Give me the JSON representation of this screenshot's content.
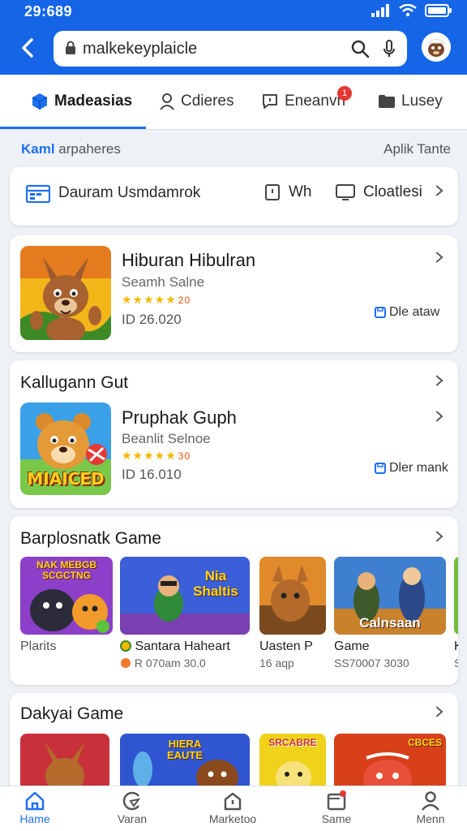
{
  "status": {
    "time": "29:689"
  },
  "search": {
    "text": "malkekeyplaicle"
  },
  "tabs": [
    {
      "label": "Madeasias"
    },
    {
      "label": "Cdieres"
    },
    {
      "label": "Eneanvn",
      "badge": "1"
    },
    {
      "label": "Lusey"
    }
  ],
  "section": {
    "left_prefix": "Kaml",
    "left_rest": " arpaheres",
    "right": "Aplik Tante"
  },
  "info_bar": {
    "item1": "Dauram Usmdamrok",
    "item2": "Wh",
    "item3": "Cloatlesi"
  },
  "app1": {
    "title": "Hiburan Hibulran",
    "subtitle": "Seamh Salne",
    "rating_stars": "★★★★★",
    "rating_num": "20",
    "price": "ID 26.020",
    "action": "Dle ataw"
  },
  "app2": {
    "section": "Kallugann Gut",
    "title": "Pruphak Guph",
    "subtitle": "Beanlit Selnoe",
    "rating_stars": "★★★★★",
    "rating_num": "30",
    "price": "ID 16.010",
    "action": "Dler mank",
    "thumb_text": "MIAICED"
  },
  "popular": {
    "title": "Barplosnatk Game",
    "games": [
      {
        "name": "Plarits",
        "meta": "",
        "thumb_text": "NAK MEBGB SCGCTNG"
      },
      {
        "name": "Santara Haheart",
        "meta": "R 070am 30.0",
        "thumb_text": "Nia Shaltis"
      },
      {
        "name": "Uasten P",
        "meta": "16 aqp",
        "thumb_text": ""
      },
      {
        "name": "Game",
        "meta": "SS70007 3030",
        "thumb_text": "Calnsaan"
      },
      {
        "name": "Ka",
        "meta": "S",
        "thumb_text": ""
      }
    ]
  },
  "daily": {
    "title": "Dakyai Game",
    "games": [
      {
        "thumb_text": ""
      },
      {
        "thumb_text": "HIERA EAUTE"
      },
      {
        "thumb_text": "SRCABRE"
      },
      {
        "thumb_text": "CBCES"
      }
    ]
  },
  "bottom_nav": [
    {
      "label": "Hame"
    },
    {
      "label": "Varan"
    },
    {
      "label": "Marketoo"
    },
    {
      "label": "Same"
    },
    {
      "label": "Menn"
    }
  ],
  "colors": {
    "primary": "#1565e6",
    "accent": "#1e6ff0",
    "star": "#f5b800",
    "badge": "#e53935"
  }
}
